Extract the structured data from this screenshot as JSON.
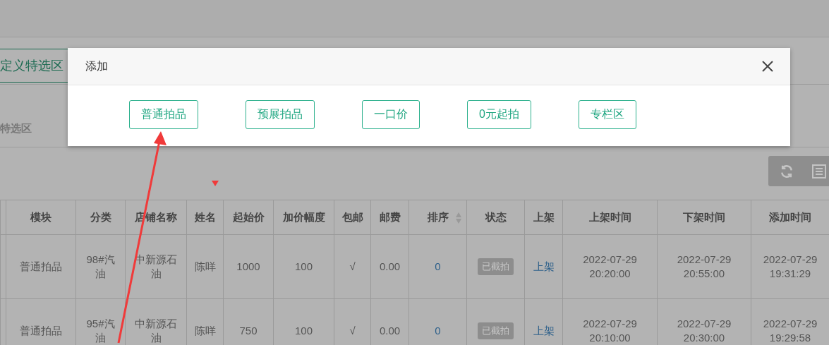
{
  "background": {
    "tab": "定义特选区",
    "section_label": "特选区"
  },
  "table": {
    "columns": [
      {
        "label": "模块",
        "sortable": false
      },
      {
        "label": "分类",
        "sortable": false
      },
      {
        "label": "店铺名称",
        "sortable": false
      },
      {
        "label": "姓名",
        "sortable": false
      },
      {
        "label": "起始价",
        "sortable": false
      },
      {
        "label": "加价幅度",
        "sortable": false
      },
      {
        "label": "包邮",
        "sortable": false
      },
      {
        "label": "邮费",
        "sortable": false
      },
      {
        "label": "排序",
        "sortable": true
      },
      {
        "label": "状态",
        "sortable": false
      },
      {
        "label": "上架",
        "sortable": false
      },
      {
        "label": "上架时间",
        "sortable": false
      },
      {
        "label": "下架时间",
        "sortable": false
      },
      {
        "label": "添加时间",
        "sortable": false
      }
    ],
    "rows": [
      {
        "module": "普通拍品",
        "category": "98#汽油",
        "shop": "中新源石油",
        "name": "陈咩",
        "start_price": "1000",
        "increment": "100",
        "free_shipping": "√",
        "shipping": "0.00",
        "sort": "0",
        "status": "已截拍",
        "shelf": "上架",
        "on_time": "2022-07-29 20:20:00",
        "off_time": "2022-07-29 20:55:00",
        "added_time": "2022-07-29 19:31:29"
      },
      {
        "module": "普通拍品",
        "category": "95#汽油",
        "shop": "中新源石油",
        "name": "陈咩",
        "start_price": "750",
        "increment": "100",
        "free_shipping": "√",
        "shipping": "0.00",
        "sort": "0",
        "status": "已截拍",
        "shelf": "上架",
        "on_time": "2022-07-29 20:10:00",
        "off_time": "2022-07-29 20:30:00",
        "added_time": "2022-07-29 19:29:58"
      }
    ]
  },
  "modal": {
    "title": "添加",
    "options": [
      "普通拍品",
      "预展拍品",
      "一口价",
      "0元起拍",
      "专栏区"
    ]
  }
}
